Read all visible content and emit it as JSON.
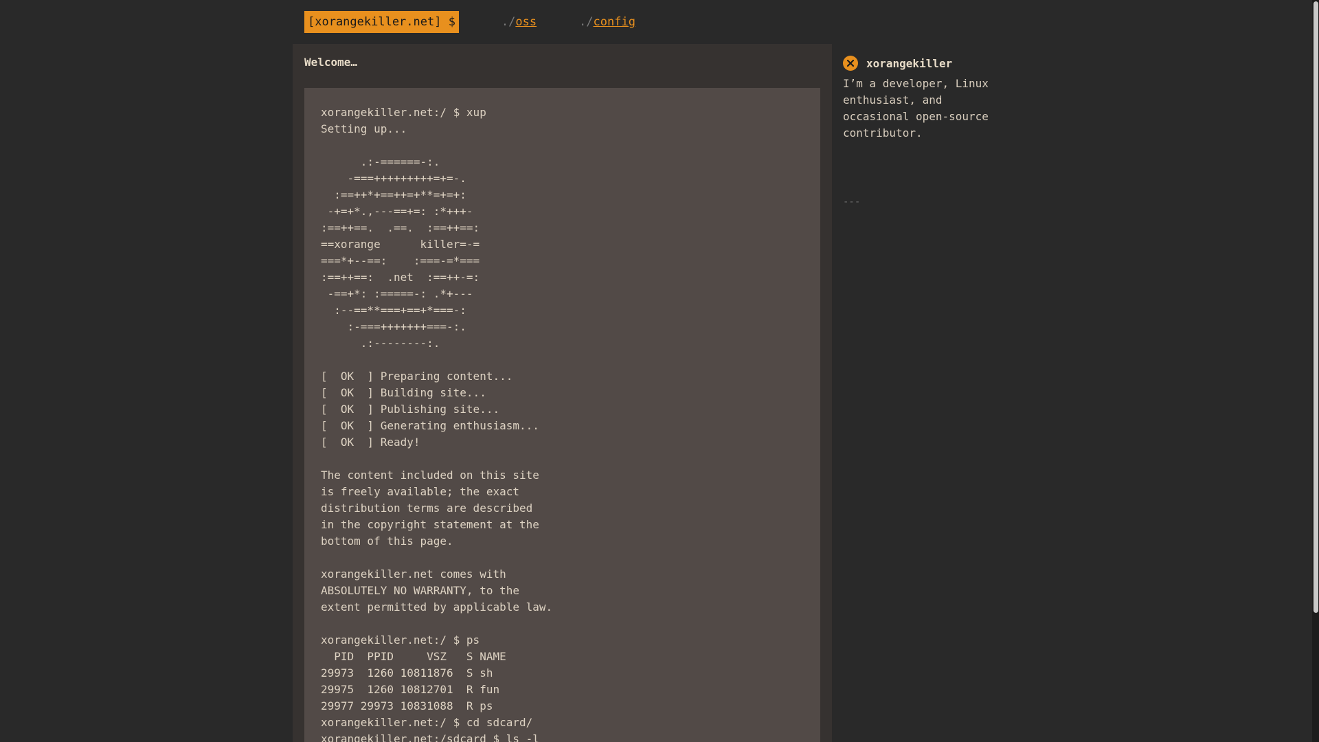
{
  "nav": {
    "brand": "[xorangekiller.net] $",
    "links": [
      {
        "prefix": "./",
        "label": "oss"
      },
      {
        "prefix": "./",
        "label": "config"
      }
    ]
  },
  "main": {
    "title": "Welcome…",
    "terminal": "xorangekiller.net:/ $ xup\nSetting up...\n\n      .:-======-:.\n    -===+++++++++=+=-.\n  :==++*+==++=+**=+=+:\n -+=+*.,---==+=: :*+++-\n:==++==.  .==.  :==++==:\n==xorange      killer=-=\n===*+--==:    :===-=*===\n:==++==:  .net  :==++-=:\n -==+*: :=====-: .*+---\n  :--==**===+==+*===-:\n    :-===+++++++===-:.\n      .:--------:.\n\n[  OK  ] Preparing content...\n[  OK  ] Building site...\n[  OK  ] Publishing site...\n[  OK  ] Generating enthusiasm...\n[  OK  ] Ready!\n\nThe content included on this site\nis freely available; the exact\ndistribution terms are described\nin the copyright statement at the\nbottom of this page.\n\nxorangekiller.net comes with\nABSOLUTELY NO WARRANTY, to the\nextent permitted by applicable law.\n\nxorangekiller.net:/ $ ps\n  PID  PPID     VSZ   S NAME\n29973  1260 10811876  S sh\n29975  1260 10812701  R fun\n29977 29973 10831088  R ps\nxorangekiller.net:/ $ cd sdcard/\nxorangekiller.net:/sdcard $ ls -l"
  },
  "sidebar": {
    "author_icon": "x-circle-icon",
    "author_name": "xorangekiller",
    "bio": "I’m a developer, Linux enthusiast, and occasional open-source contributor.",
    "divider": "---"
  },
  "colors": {
    "accent": "#e8901e",
    "page_background": "#292929",
    "main_background": "#363230",
    "terminal_background": "#524a47",
    "text": "#d8cdbd"
  }
}
